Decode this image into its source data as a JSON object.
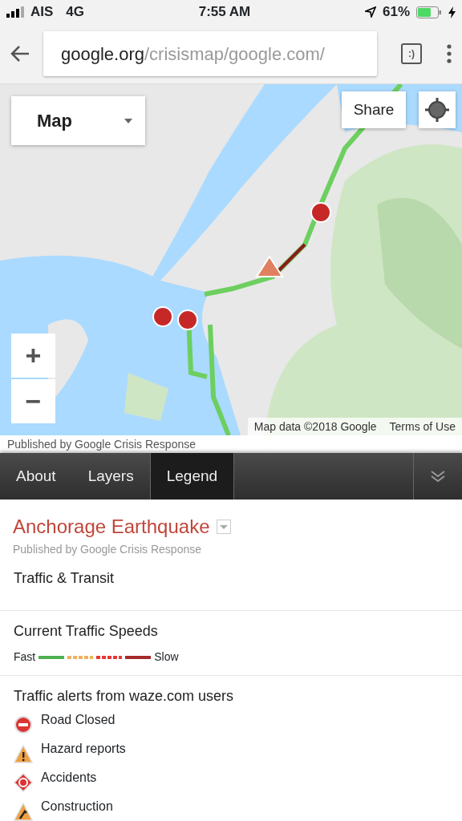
{
  "status_bar": {
    "carrier": "AIS",
    "network": "4G",
    "time": "7:55 AM",
    "battery": "61%"
  },
  "browser": {
    "url_host": "google.org",
    "url_path": "/crisismap/google.com/",
    "tab_button": ":)"
  },
  "map": {
    "kind": "picture",
    "layer_select": "Map",
    "share": "Share",
    "zoom_in": "+",
    "zoom_out": "−",
    "attribution": "Map data ©2018 Google",
    "terms": "Terms of Use"
  },
  "publisher_line": "Published by Google Crisis Response",
  "tabs": [
    {
      "label": "About",
      "selected": false
    },
    {
      "label": "Layers",
      "selected": false
    },
    {
      "label": "Legend",
      "selected": true
    }
  ],
  "legend": {
    "title": "Anchorage Earthquake",
    "subtitle": "Published by Google Crisis Response",
    "sections": [
      {
        "title": "Traffic & Transit"
      },
      {
        "title": "Current Traffic Speeds",
        "fast": "Fast",
        "slow": "Slow",
        "speeds": [
          {
            "kind": "solid",
            "color": "#4caf50"
          },
          {
            "kind": "dashed",
            "color": "#f0b060"
          },
          {
            "kind": "dashed",
            "color": "#e53935"
          },
          {
            "kind": "solid",
            "color": "#a52a2a"
          }
        ]
      },
      {
        "title": "Traffic alerts from waze.com users",
        "alerts": [
          {
            "kind": "road_closed",
            "label": "Road Closed"
          },
          {
            "kind": "hazard",
            "label": "Hazard reports"
          },
          {
            "kind": "accident",
            "label": "Accidents"
          },
          {
            "kind": "construction",
            "label": "Construction"
          }
        ]
      }
    ]
  }
}
